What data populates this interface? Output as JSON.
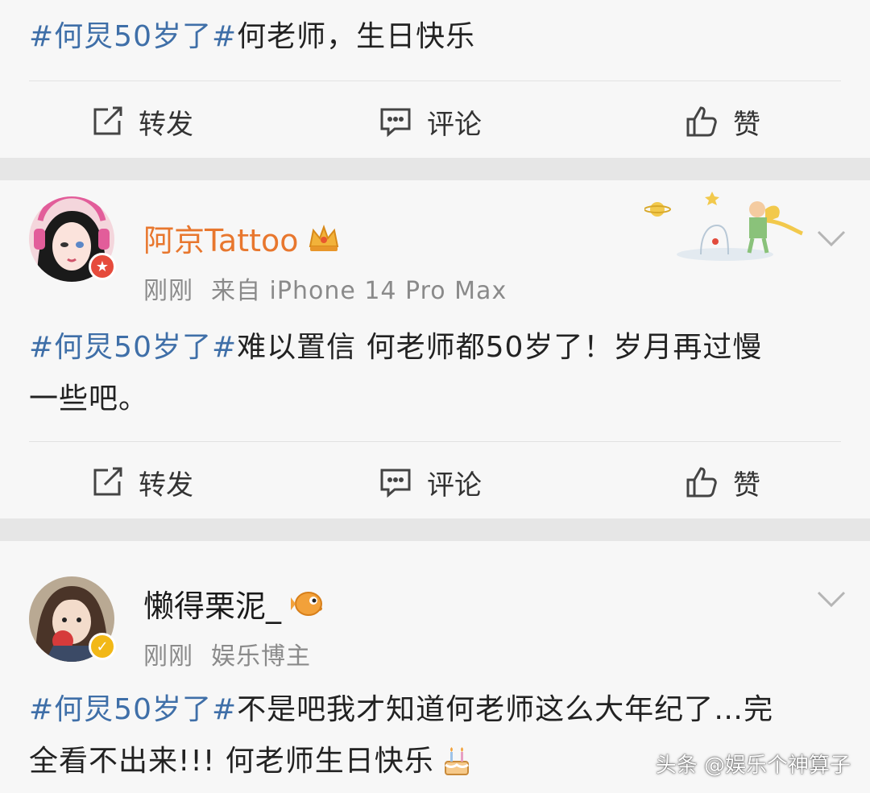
{
  "posts": [
    {
      "hashtag": "#何炅50岁了#",
      "text": "何老师，生日快乐",
      "actions": {
        "repost": "转发",
        "comment": "评论",
        "like": "赞"
      }
    },
    {
      "username": "阿京Tattoo",
      "time": "刚刚",
      "source": "来自 iPhone 14 Pro Max",
      "hashtag": "#何炅50岁了#",
      "text_line1": "难以置信 何老师都50岁了！岁月再过慢",
      "text_line2": "一些吧。",
      "actions": {
        "repost": "转发",
        "comment": "评论",
        "like": "赞"
      },
      "username_color": "#e8772e"
    },
    {
      "username": "懒得栗泥_",
      "time": "刚刚",
      "source": "娱乐博主",
      "hashtag": "#何炅50岁了#",
      "text_line1": "不是吧我才知道何老师这么大年纪了…完",
      "text_line2": "全看不出来!!! 何老师生日快乐",
      "username_color": "#1a1a1a"
    }
  ],
  "watermark": "头条 @娱乐个神算子",
  "colors": {
    "hashtag": "#3f6fa8",
    "meta": "#8a8a8a",
    "gap": "#e6e6e6"
  }
}
